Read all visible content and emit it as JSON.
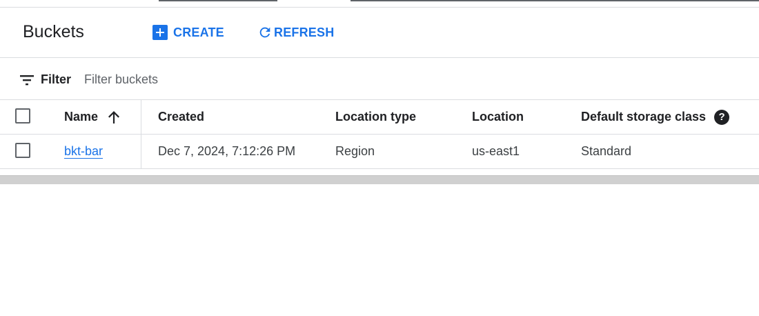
{
  "header": {
    "title": "Buckets",
    "create_label": "CREATE",
    "refresh_label": "REFRESH"
  },
  "filter": {
    "label": "Filter",
    "placeholder": "Filter buckets",
    "value": ""
  },
  "table": {
    "columns": {
      "name": "Name",
      "created": "Created",
      "location_type": "Location type",
      "location": "Location",
      "storage_class": "Default storage class"
    },
    "sort": {
      "column": "name",
      "direction": "ascending"
    },
    "rows": [
      {
        "name": "bkt-bar",
        "created": "Dec 7, 2024, 7:12:26 PM",
        "location_type": "Region",
        "location": "us-east1",
        "storage_class": "Standard",
        "checked": false
      }
    ]
  },
  "colors": {
    "accent": "#1a73e8",
    "text": "#202124",
    "muted": "#5f6368",
    "divider": "#dadce0"
  },
  "icons": {
    "create": "add-box-icon",
    "refresh": "refresh-icon",
    "filter": "filter-list-icon",
    "sort": "arrow-upward-icon",
    "help": "help-icon"
  }
}
